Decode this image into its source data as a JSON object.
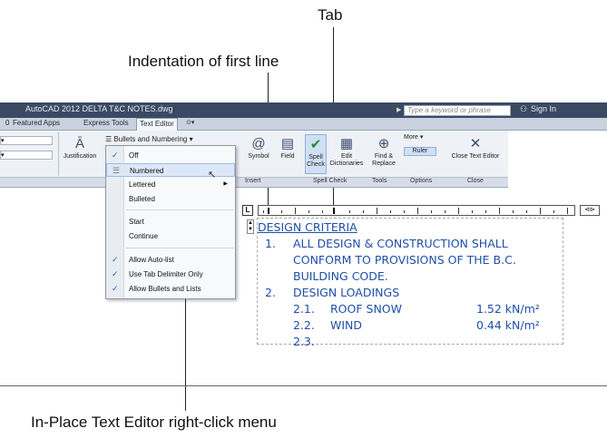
{
  "callouts": {
    "tab": "Tab",
    "indentation": "Indentation of first line",
    "menu": "In-Place Text Editor right-click menu"
  },
  "window": {
    "title": "AutoCAD 2012   DELTA T&C NOTES.dwg",
    "search_placeholder": "Type a keyword or phrase",
    "sign_in": "Sign In"
  },
  "tabs": [
    "0",
    "Featured Apps",
    "Express Tools",
    "Text Editor"
  ],
  "ribbon": {
    "justification": "Justification",
    "bullets": "Bullets and Numbering",
    "symbol": "Symbol",
    "field": "Field",
    "spell_check": "Spell Check",
    "edit_dictionaries": "Edit Dictionaries",
    "find_replace": "Find & Replace",
    "more": "More",
    "ruler": "Ruler",
    "close_text_editor": "Close Text Editor",
    "groups": [
      "Insert",
      "Spell Check",
      "Tools",
      "Options",
      "Close"
    ]
  },
  "menu": {
    "items": [
      {
        "label": "Off",
        "checked": true
      },
      {
        "label": "Numbered",
        "checked": false,
        "highlighted": true
      },
      {
        "label": "Lettered",
        "checked": false,
        "submenu": true
      },
      {
        "label": "Bulleted",
        "checked": false
      },
      {
        "label": "Start",
        "checked": false
      },
      {
        "label": "Continue",
        "checked": false
      },
      {
        "label": "Allow Auto-list",
        "checked": true
      },
      {
        "label": "Use Tab Delimiter Only",
        "checked": true
      },
      {
        "label": "Allow Bullets and Lists",
        "checked": true
      }
    ]
  },
  "editor": {
    "heading": "DESIGN CRITERIA",
    "line1_num": "1.",
    "line1": "ALL DESIGN & CONSTRUCTION SHALL",
    "line1b": "CONFORM TO PROVISIONS OF THE B.C.",
    "line1c": "BUILDING CODE.",
    "line2_num": "2.",
    "line2": "DESIGN LOADINGS",
    "l21_num": "2.1.",
    "l21": "ROOF SNOW",
    "l21_val": "1.52 kN/m²",
    "l22_num": "2.2.",
    "l22": "WIND",
    "l22_val": "0.44 kN/m²",
    "l23_num": "2.3."
  }
}
